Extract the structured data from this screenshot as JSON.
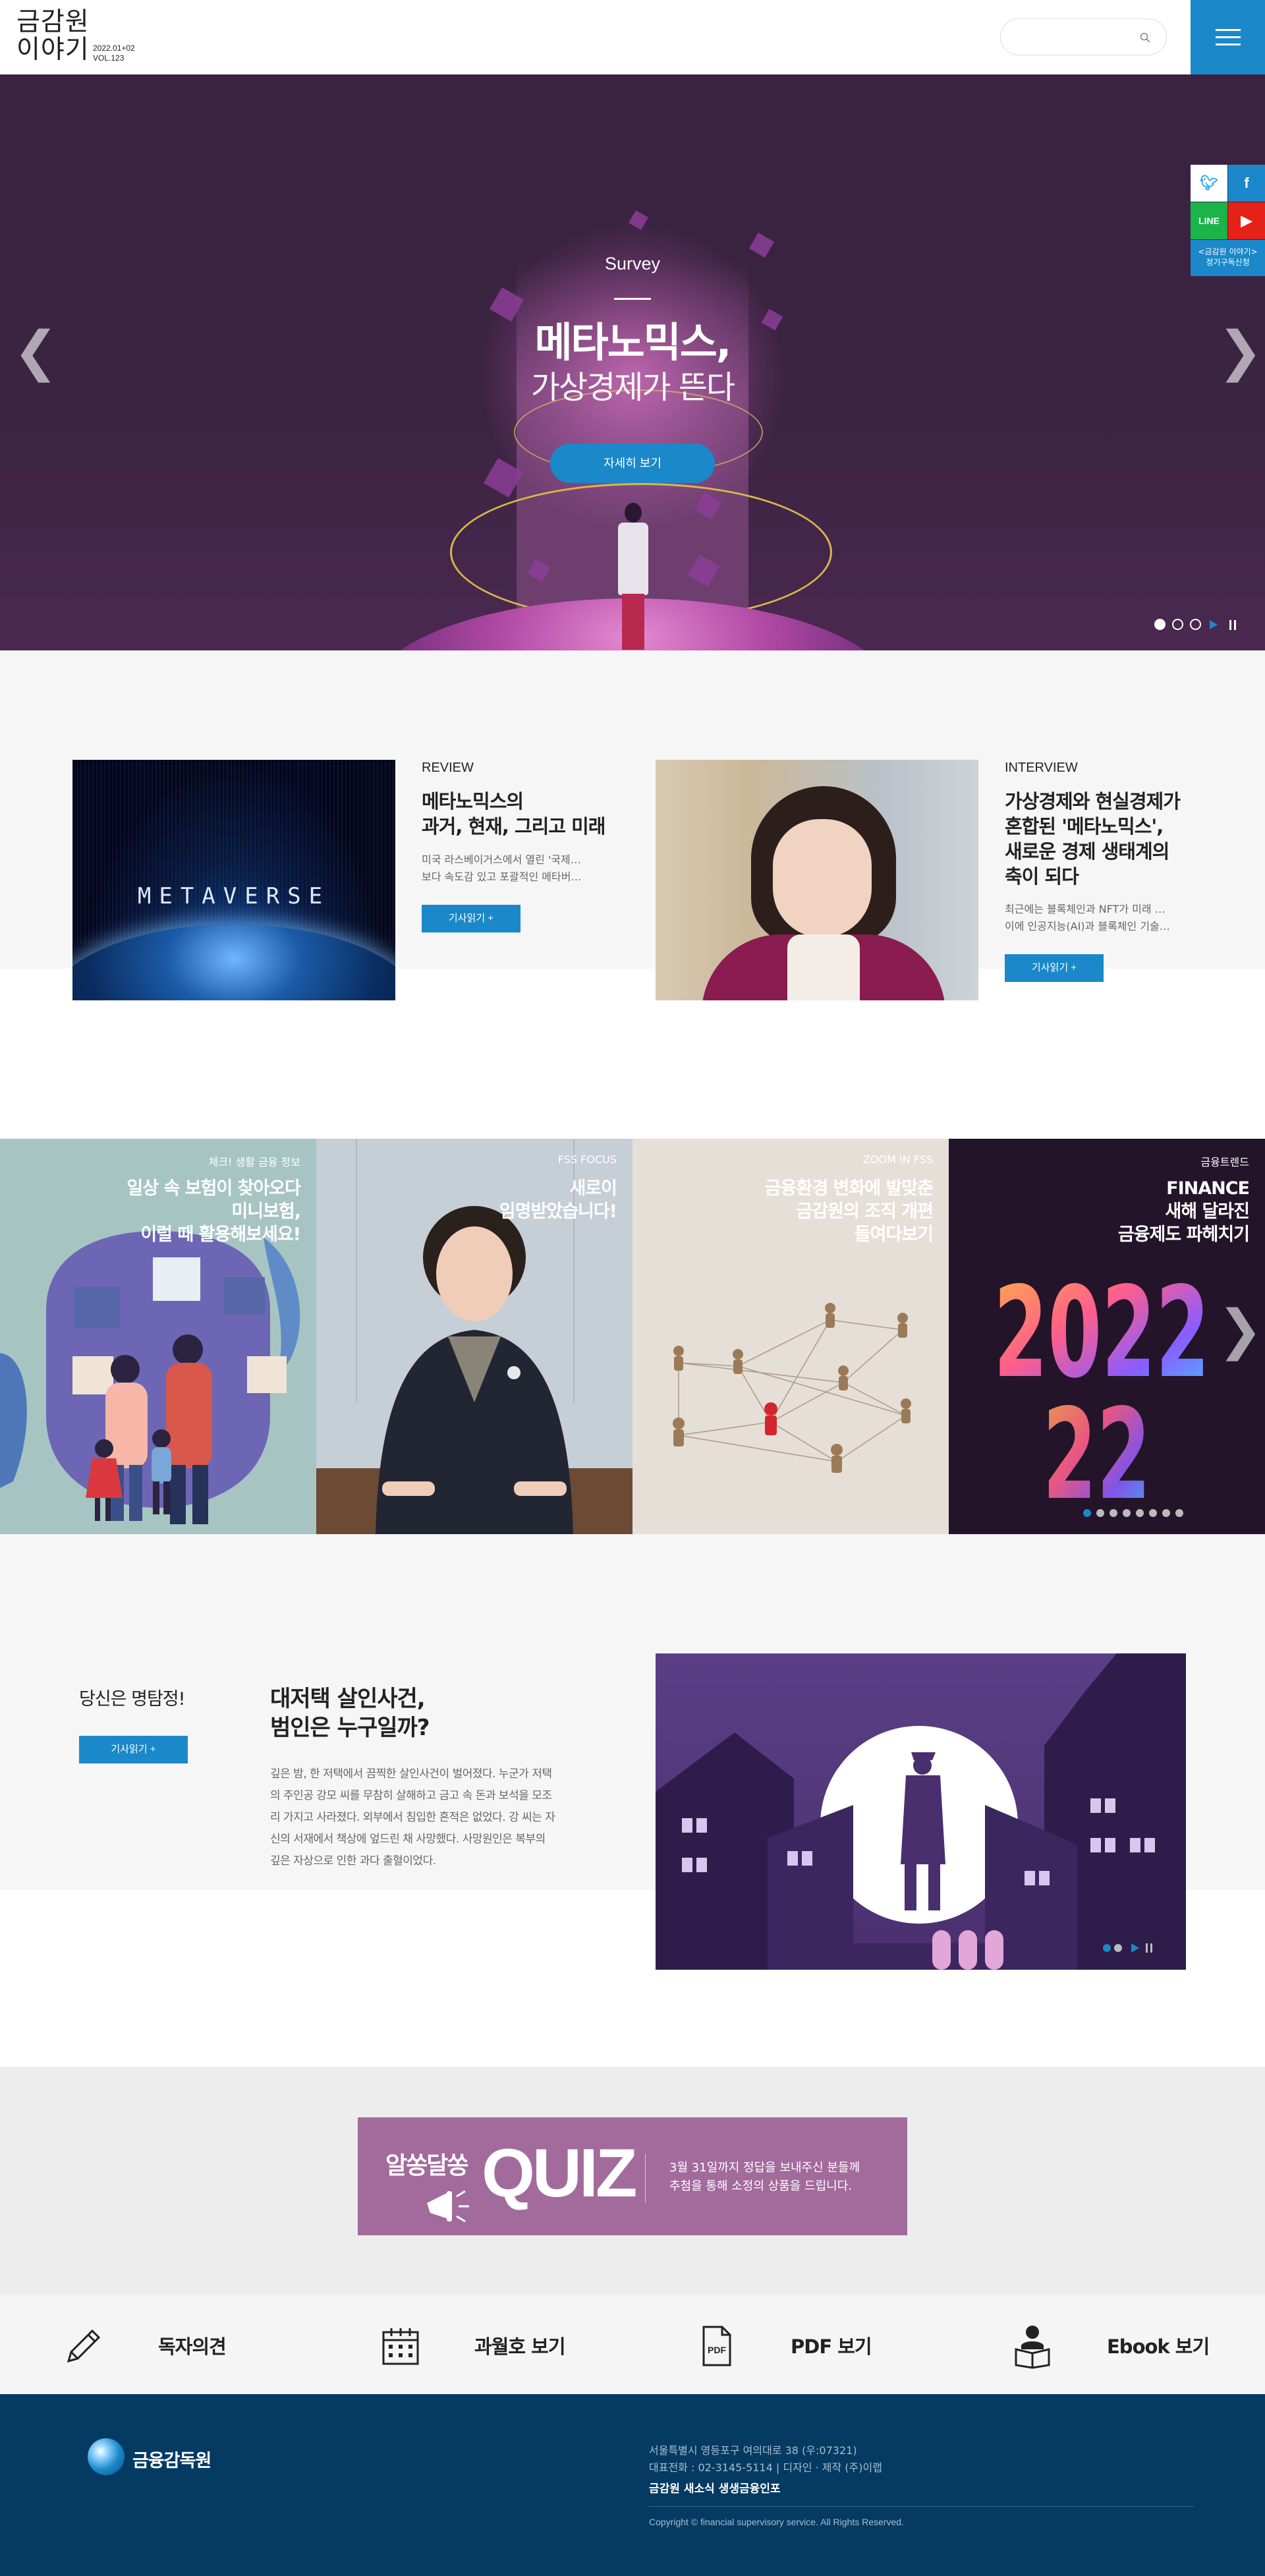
{
  "header": {
    "logo": {
      "line1": "금감원",
      "line2": "이야기",
      "issue_date": "2022.01+02",
      "volume": "VOL.123"
    },
    "search": {
      "placeholder": "",
      "icon": "search-icon"
    },
    "menu_icon": "hamburger-icon",
    "accent_color": "#1a88c9"
  },
  "hero": {
    "eyebrow": "Survey",
    "title": "메타노믹스,",
    "subtitle": "가상경제가 뜬다",
    "cta_label": "자세히 보기",
    "prev_icon": "chevron-left-icon",
    "next_icon": "chevron-right-icon",
    "slides": 3,
    "active_slide": 1
  },
  "social": {
    "twitter_icon": "twitter-icon",
    "facebook_icon": "facebook-icon",
    "line_icon": "line-icon",
    "youtube_icon": "youtube-icon",
    "subscribe_line1": "<금감원 이야기>",
    "subscribe_line2": "정기구독신청"
  },
  "articles": [
    {
      "category": "REVIEW",
      "title_lines": [
        "메타노믹스의",
        "과거, 현재, 그리고 미래"
      ],
      "summary_lines": [
        "미국 라스베이거스에서 열린 '국제…",
        "보다 속도감 있고 포괄적인 메타버…"
      ],
      "image_text": "METAVERSE",
      "button_label": "기사읽기 +"
    },
    {
      "category": "INTERVIEW",
      "title_lines": [
        "가상경제와 현실경제가",
        "혼합된 '메타노믹스',",
        "새로운 경제 생태계의",
        "축이 되다"
      ],
      "summary_lines": [
        "최근에는 블록체인과 NFT가 미래 …",
        "이에 인공지능(AI)과 블록체인 기술…"
      ],
      "button_label": "기사읽기 +"
    }
  ],
  "tiles": [
    {
      "category": "체크! 생활 금융 정보",
      "title": "일상 속 보험이 찾아오다\n미니보험,\n이럴 때 활용해보세요!"
    },
    {
      "category": "FSS FOCUS",
      "title": "새로이\n임명받았습니다!"
    },
    {
      "category": "ZOOM IN FSS",
      "title": "금융환경 변화에 발맞춘\n금감원의 조직 개편\n들여다보기"
    },
    {
      "category": "금융트렌드",
      "title": "FINANCE\n새해 달라진\n금융제도 파헤치기",
      "number_art": "2022"
    }
  ],
  "tiles_pager": {
    "count": 8,
    "active": 1,
    "next_icon": "chevron-right-icon"
  },
  "detective": {
    "label": "당신은 명탐정!",
    "button_label": "기사읽기 +",
    "title_lines": [
      "대저택 살인사건,",
      "범인은 누구일까?"
    ],
    "body_lines": [
      "깊은 밤, 한 저택에서 끔찍한 살인사건이 벌어졌다. 누군가 저택",
      "의 주인공 강모 씨를 무참히 살해하고 금고 속 돈과 보석을 모조",
      "리 가지고 사라졌다. 외부에서 침입한 흔적은 없었다. 강 씨는 자",
      "신의 서재에서 책상에 엎드린 채 사망했다. 사망원인은 복부의",
      "깊은 자상으로 인한 과다 출혈이었다."
    ]
  },
  "quiz": {
    "small_title": "알쏭달쏭",
    "big_title": "QUIZ",
    "text_lines": [
      "3월 31일까지 정답을 보내주신 분들께",
      "추첨을 통해 소정의 상품을 드립니다."
    ],
    "megaphone_icon": "megaphone-icon"
  },
  "quick_links": [
    {
      "label": "독자의견",
      "icon": "pencil-icon"
    },
    {
      "label": "과월호 보기",
      "icon": "calendar-icon"
    },
    {
      "label": "PDF 보기",
      "icon": "pdf-file-icon"
    },
    {
      "label": "Ebook 보기",
      "icon": "reader-book-icon"
    }
  ],
  "footer": {
    "org_name": "금융감독원",
    "address": "서울특별시 영등포구 여의대로 38 (우:07321)",
    "contact": "대표전화 : 02-3145-5114 | 디자인 · 제작 (주)이랩",
    "motto": "금감원 새소식  생생금융인포",
    "copyright": "Copyright © financial supervisory service. All Rights Reserved.",
    "background_color": "#053a63"
  }
}
